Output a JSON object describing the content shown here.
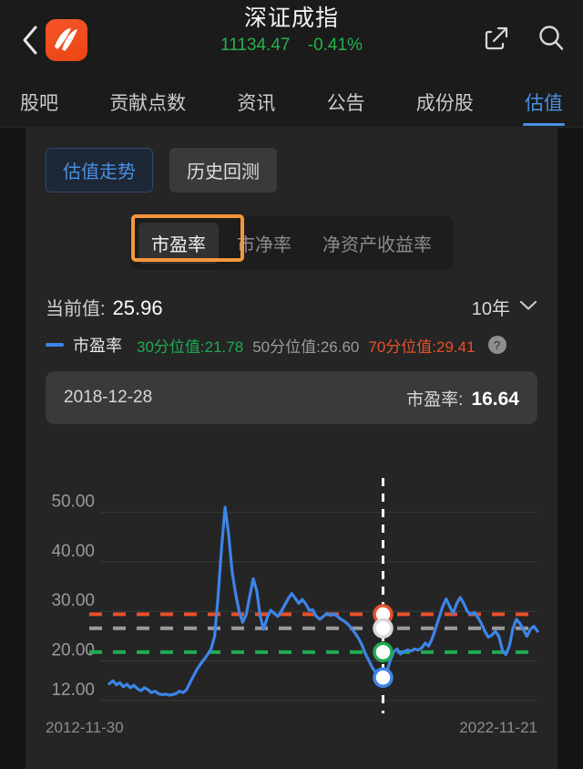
{
  "header": {
    "back_icon": "chevron-left-icon",
    "logo_icon": "eastmoney-logo-icon",
    "index_name": "深证成指",
    "index_value": "11134.47",
    "index_change_pct": "-0.41%",
    "change_color": "#24b24c",
    "share_icon": "share-external-icon",
    "search_icon": "search-icon"
  },
  "tabs": [
    {
      "label": "股吧",
      "active": false
    },
    {
      "label": "贡献点数",
      "active": false
    },
    {
      "label": "资讯",
      "active": false
    },
    {
      "label": "公告",
      "active": false
    },
    {
      "label": "成份股",
      "active": false
    },
    {
      "label": "估值",
      "active": true
    }
  ],
  "segments": [
    {
      "label": "估值走势",
      "active": true
    },
    {
      "label": "历史回测",
      "active": false
    }
  ],
  "metrics": [
    {
      "label": "市盈率",
      "active": true
    },
    {
      "label": "市净率",
      "active": false
    },
    {
      "label": "净资产收益率",
      "active": false
    }
  ],
  "highlight": {
    "target": "市盈率",
    "color": "#f5963c"
  },
  "current": {
    "label": "当前值:",
    "value": "25.96",
    "range_label": "10年",
    "range_icon": "chevron-down-icon"
  },
  "legend": {
    "series_name": "市盈率",
    "series_color": "#3d84e8",
    "p30_text": "30分位值:21.78",
    "p50_text": "50分位值:26.60",
    "p70_text": "70分位值:29.41",
    "p30_color": "#1faa52",
    "p50_color": "#9a9a9a",
    "p70_color": "#e8502a",
    "help_icon": "question-mark-icon",
    "help_glyph": "?"
  },
  "tooltip": {
    "date": "2018-12-28",
    "metric_label": "市盈率:",
    "metric_value": "16.64"
  },
  "chart_data": {
    "type": "line",
    "title": "市盈率",
    "xlabel": "",
    "ylabel": "",
    "x_start": "2012-11-30",
    "x_end": "2022-11-21",
    "y_ticks": [
      "50.00",
      "40.00",
      "30.00",
      "20.00",
      "12.00"
    ],
    "ylim": [
      12.0,
      52.5
    ],
    "grid": true,
    "legend_position": "above-chart",
    "reference_lines": [
      {
        "name": "70分位值",
        "value": 29.41,
        "color": "#e8502a",
        "style": "dashed"
      },
      {
        "name": "50分位值",
        "value": 26.6,
        "color": "#9a9a9a",
        "style": "dashed"
      },
      {
        "name": "30分位值",
        "value": 21.78,
        "color": "#1faa52",
        "style": "dashed"
      }
    ],
    "cursor": {
      "date": "2018-12-28",
      "series_value": 16.64,
      "markers": [
        29.41,
        26.6,
        21.78,
        16.64
      ],
      "marker_colors": [
        "#e8502a",
        "#d8d8d8",
        "#1faa52",
        "#3d84e8"
      ],
      "line_style": "dashed-white"
    },
    "series": [
      {
        "name": "市盈率",
        "color": "#3d84e8",
        "values": [
          15.4,
          16.0,
          15.2,
          15.6,
          14.8,
          15.3,
          14.6,
          15.1,
          14.4,
          14.0,
          14.6,
          14.2,
          13.6,
          13.9,
          13.4,
          13.2,
          13.3,
          13.1,
          13.2,
          13.4,
          13.9,
          13.6,
          14.2,
          15.6,
          17.0,
          18.3,
          19.4,
          20.3,
          21.3,
          22.4,
          25.0,
          33.0,
          43.0,
          51.0,
          45.5,
          38.0,
          33.5,
          30.0,
          27.8,
          29.3,
          33.0,
          36.6,
          34.2,
          29.0,
          26.4,
          28.8,
          30.2,
          29.6,
          29.0,
          30.0,
          31.3,
          32.6,
          33.6,
          32.6,
          31.6,
          32.4,
          31.5,
          30.2,
          30.3,
          29.0,
          28.4,
          29.0,
          29.6,
          29.2,
          29.5,
          29.0,
          28.4,
          28.0,
          27.4,
          26.6,
          25.6,
          24.6,
          23.2,
          21.4,
          20.0,
          18.6,
          17.6,
          16.9,
          16.64,
          17.6,
          20.0,
          21.8,
          22.4,
          21.4,
          21.9,
          22.2,
          22.0,
          22.4,
          22.2,
          22.6,
          23.6,
          23.0,
          24.5,
          26.6,
          28.8,
          31.0,
          32.5,
          31.0,
          29.6,
          31.6,
          32.8,
          31.6,
          30.0,
          29.4,
          29.8,
          28.8,
          27.6,
          26.0,
          24.8,
          25.2,
          26.0,
          25.0,
          22.2,
          21.3,
          23.0,
          26.5,
          28.4,
          27.6,
          26.3,
          25.0,
          26.4,
          27.0,
          26.0
        ]
      }
    ]
  }
}
